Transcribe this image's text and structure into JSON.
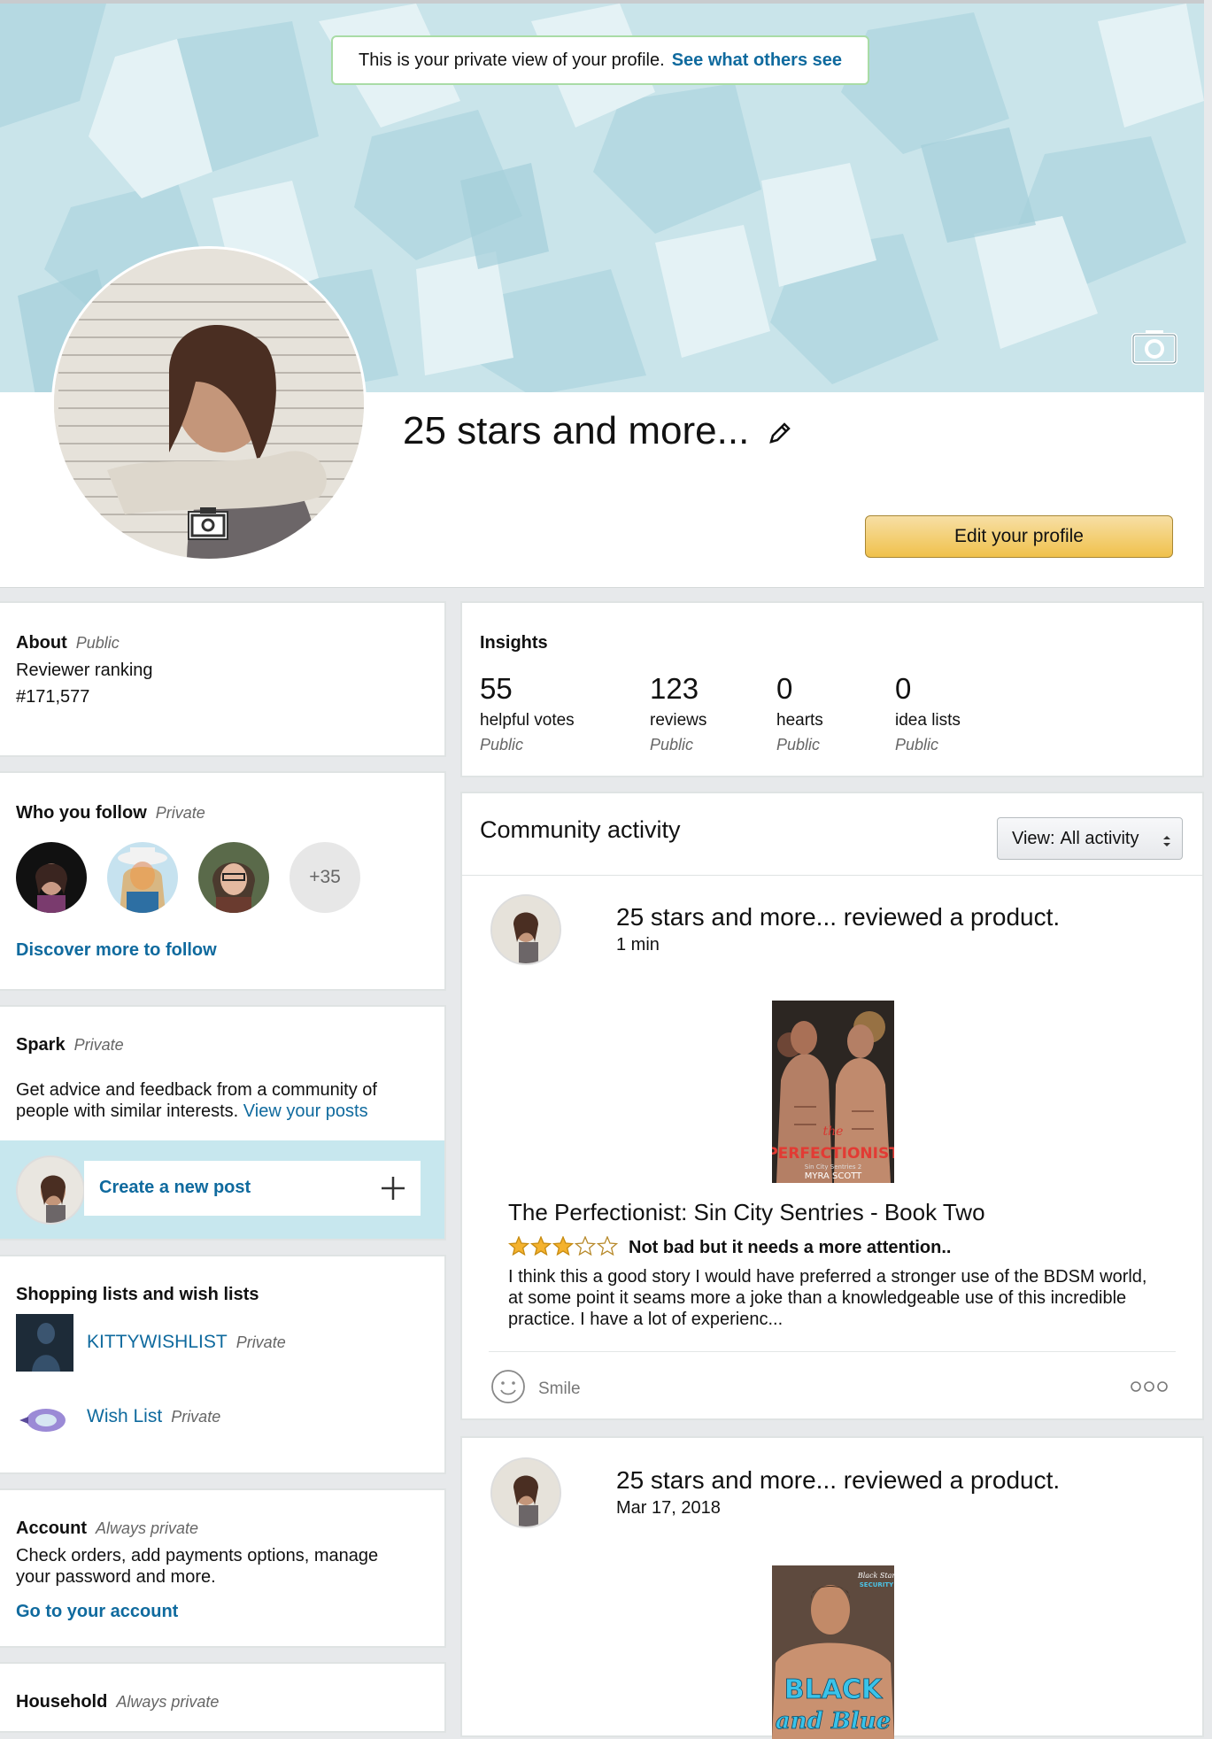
{
  "banner": {
    "text": "This is your private view of your profile.",
    "link": "See what others see"
  },
  "profile": {
    "name": "25 stars and more...",
    "edit_label": "Edit your profile"
  },
  "about": {
    "title": "About",
    "privacy": "Public",
    "ranking_label": "Reviewer ranking",
    "ranking": "#171,577"
  },
  "follow": {
    "title": "Who you follow",
    "privacy": "Private",
    "more": "+35",
    "discover": "Discover more to follow"
  },
  "spark": {
    "title": "Spark",
    "privacy": "Private",
    "desc": "Get advice and feedback from a community of people with similar interests.",
    "link": "View your posts",
    "create": "Create a new post"
  },
  "lists": {
    "title": "Shopping lists and wish lists",
    "items": [
      {
        "name": "KITTYWISHLIST",
        "privacy": "Private"
      },
      {
        "name": "Wish List",
        "privacy": "Private"
      }
    ]
  },
  "account": {
    "title": "Account",
    "privacy": "Always private",
    "desc": "Check orders, add payments options, manage your password and more.",
    "link": "Go to your account"
  },
  "household": {
    "title": "Household",
    "privacy": "Always private"
  },
  "insights": {
    "title": "Insights",
    "stats": [
      {
        "value": "55",
        "label": "helpful votes",
        "privacy": "Public"
      },
      {
        "value": "123",
        "label": "reviews",
        "privacy": "Public"
      },
      {
        "value": "0",
        "label": "hearts",
        "privacy": "Public"
      },
      {
        "value": "0",
        "label": "idea lists",
        "privacy": "Public"
      }
    ]
  },
  "activity": {
    "title": "Community activity",
    "view_label": "View:",
    "view_value": "All activity",
    "items": [
      {
        "headline": "25 stars and more... reviewed a product.",
        "time": "1 min",
        "product": "The Perfectionist: Sin City Sentries - Book Two",
        "rating": 3,
        "review_title": "Not bad but it needs a more attention..",
        "review_text": "I think this a good story I would have preferred a stronger use of the BDSM world, at some point it seams more a joke than a knowledgeable use of this incredible practice. I have a lot of experienc...",
        "smile": "Smile",
        "cover_title": "the",
        "cover_big": "PERFECTIONIST",
        "cover_series": "Sin City Sentries 2",
        "cover_author": "MYRA SCOTT"
      },
      {
        "headline": "25 stars and more... reviewed a product.",
        "time": "Mar 17, 2018",
        "cover_top": "Black Star",
        "cover_top2": "SECURITY",
        "cover_big": "BLACK",
        "cover_big2": "and Blue"
      }
    ]
  }
}
